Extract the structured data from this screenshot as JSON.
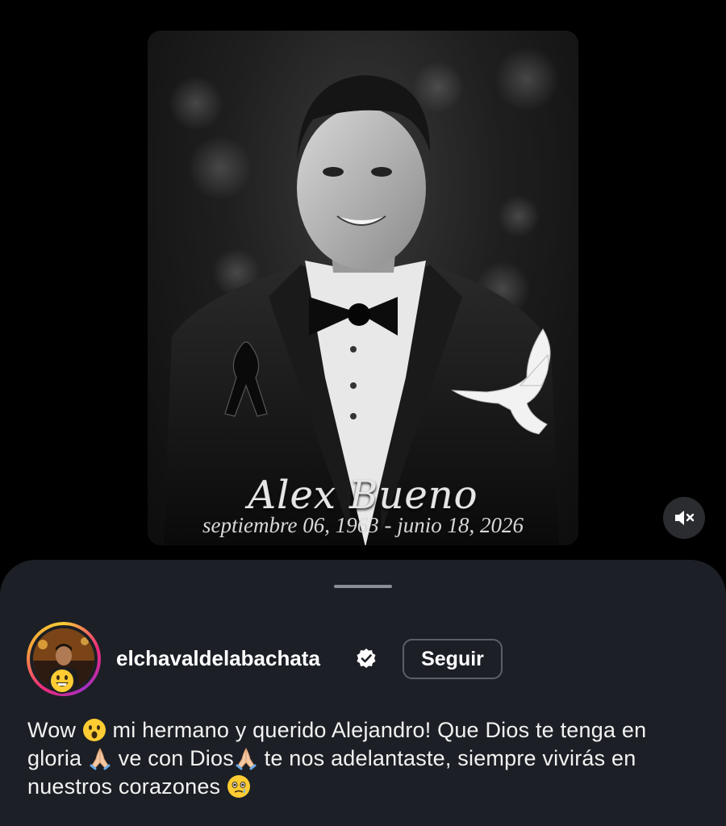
{
  "media": {
    "name": "Alex Bueno",
    "dates": "septiembre 06, 1963 - junio 18, 2026"
  },
  "controls": {
    "mute_icon": "speaker-muted-icon"
  },
  "post": {
    "username": "elchavaldelabachata",
    "verified_icon": "verified-badge-icon",
    "follow_label": "Seguir",
    "caption": {
      "part1": "Wow ",
      "emoji1": "astonished-face-emoji",
      "part2": " mi hermano y querido Alejandro! Que Dios te tenga en gloria ",
      "emoji2": "praying-hands-emoji",
      "part3": " ve con Dios",
      "emoji3": "praying-hands-emoji",
      "part4": " te nos adelantaste, siempre vivirás en nuestros corazones ",
      "emoji4": "face-holding-back-tears-emoji"
    }
  },
  "colors": {
    "sheet_bg": "#1c1f25",
    "follow_border": "#5b5f66",
    "verified": "#ffffff"
  }
}
